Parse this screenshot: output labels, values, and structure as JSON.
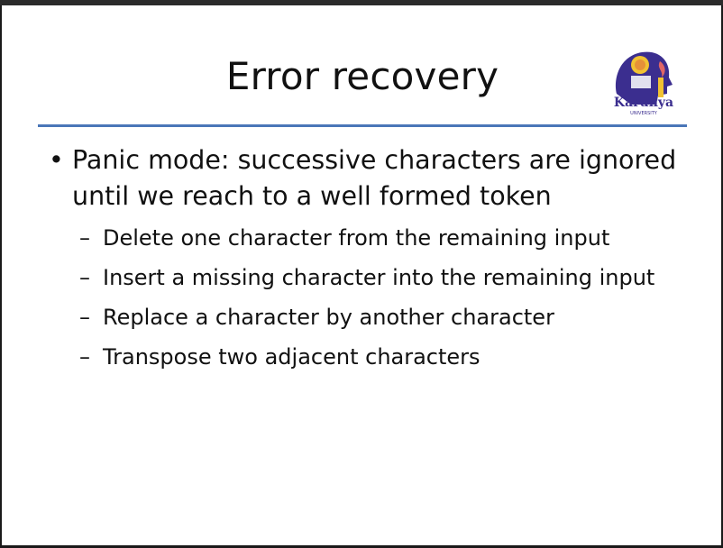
{
  "slide": {
    "title": "Error recovery",
    "logo": {
      "icon": "karunya-university-logo",
      "text": "Karunya",
      "subtext": "UNIVERSITY"
    },
    "accent_color": "#4a76b8",
    "bullet": {
      "marker": "•",
      "text": "Panic mode: successive characters are ignored until we reach to a well formed token",
      "sub_marker": "–",
      "subitems": [
        "Delete one character from the remaining input",
        "Insert a missing character into the remaining input",
        "Replace a character by another character",
        "Transpose two adjacent characters"
      ]
    }
  }
}
